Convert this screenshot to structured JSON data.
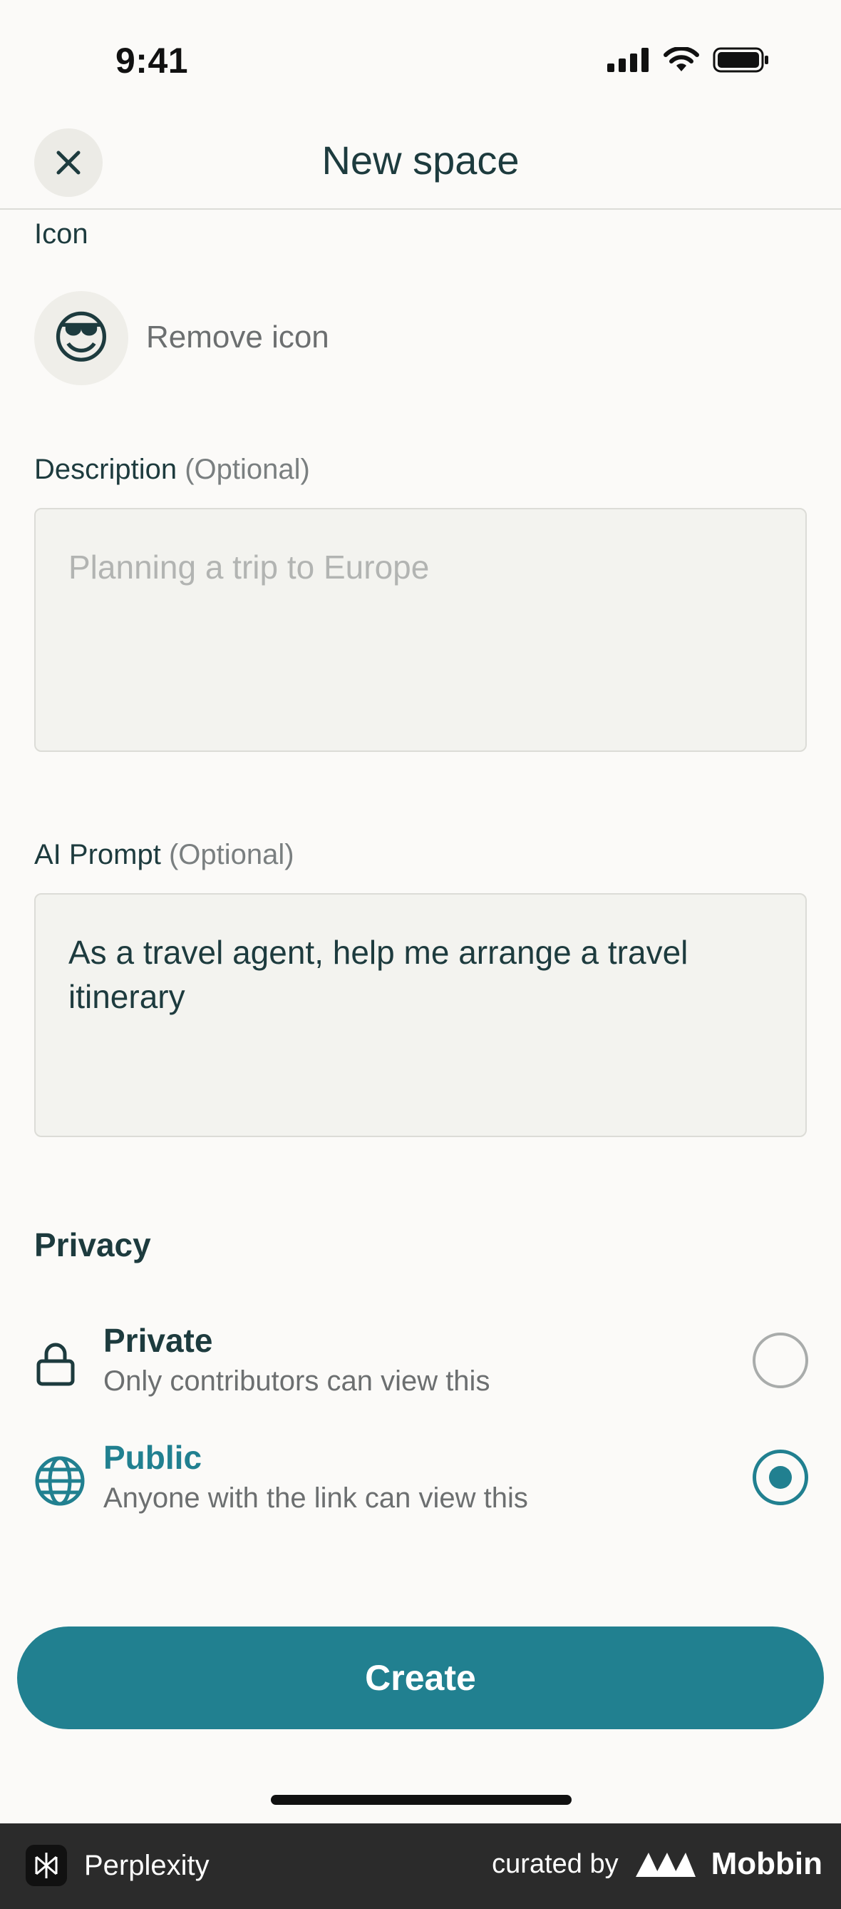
{
  "status_bar": {
    "time": "9:41"
  },
  "header": {
    "title": "New space"
  },
  "icon_section": {
    "label": "Icon",
    "remove_label": "Remove icon",
    "emoji": "😎"
  },
  "description": {
    "label": "Description",
    "optional": "(Optional)",
    "placeholder": "Planning a trip to Europe"
  },
  "ai_prompt": {
    "label": "AI Prompt",
    "optional": "(Optional)",
    "value": "As a travel agent, help me arrange a travel itinerary"
  },
  "privacy": {
    "title": "Privacy",
    "options": [
      {
        "title": "Private",
        "description": "Only contributors can view this",
        "selected": false,
        "icon": "lock-icon"
      },
      {
        "title": "Public",
        "description": "Anyone with the link can view this",
        "selected": true,
        "icon": "globe-icon"
      }
    ]
  },
  "create_button": {
    "label": "Create"
  },
  "footer": {
    "app_name": "Perplexity",
    "curated_by": "curated by",
    "brand": "Mobbin"
  },
  "colors": {
    "accent": "#218090",
    "text": "#1d3b3e",
    "background": "#fbfaf8",
    "footer": "#2b2b2b"
  }
}
